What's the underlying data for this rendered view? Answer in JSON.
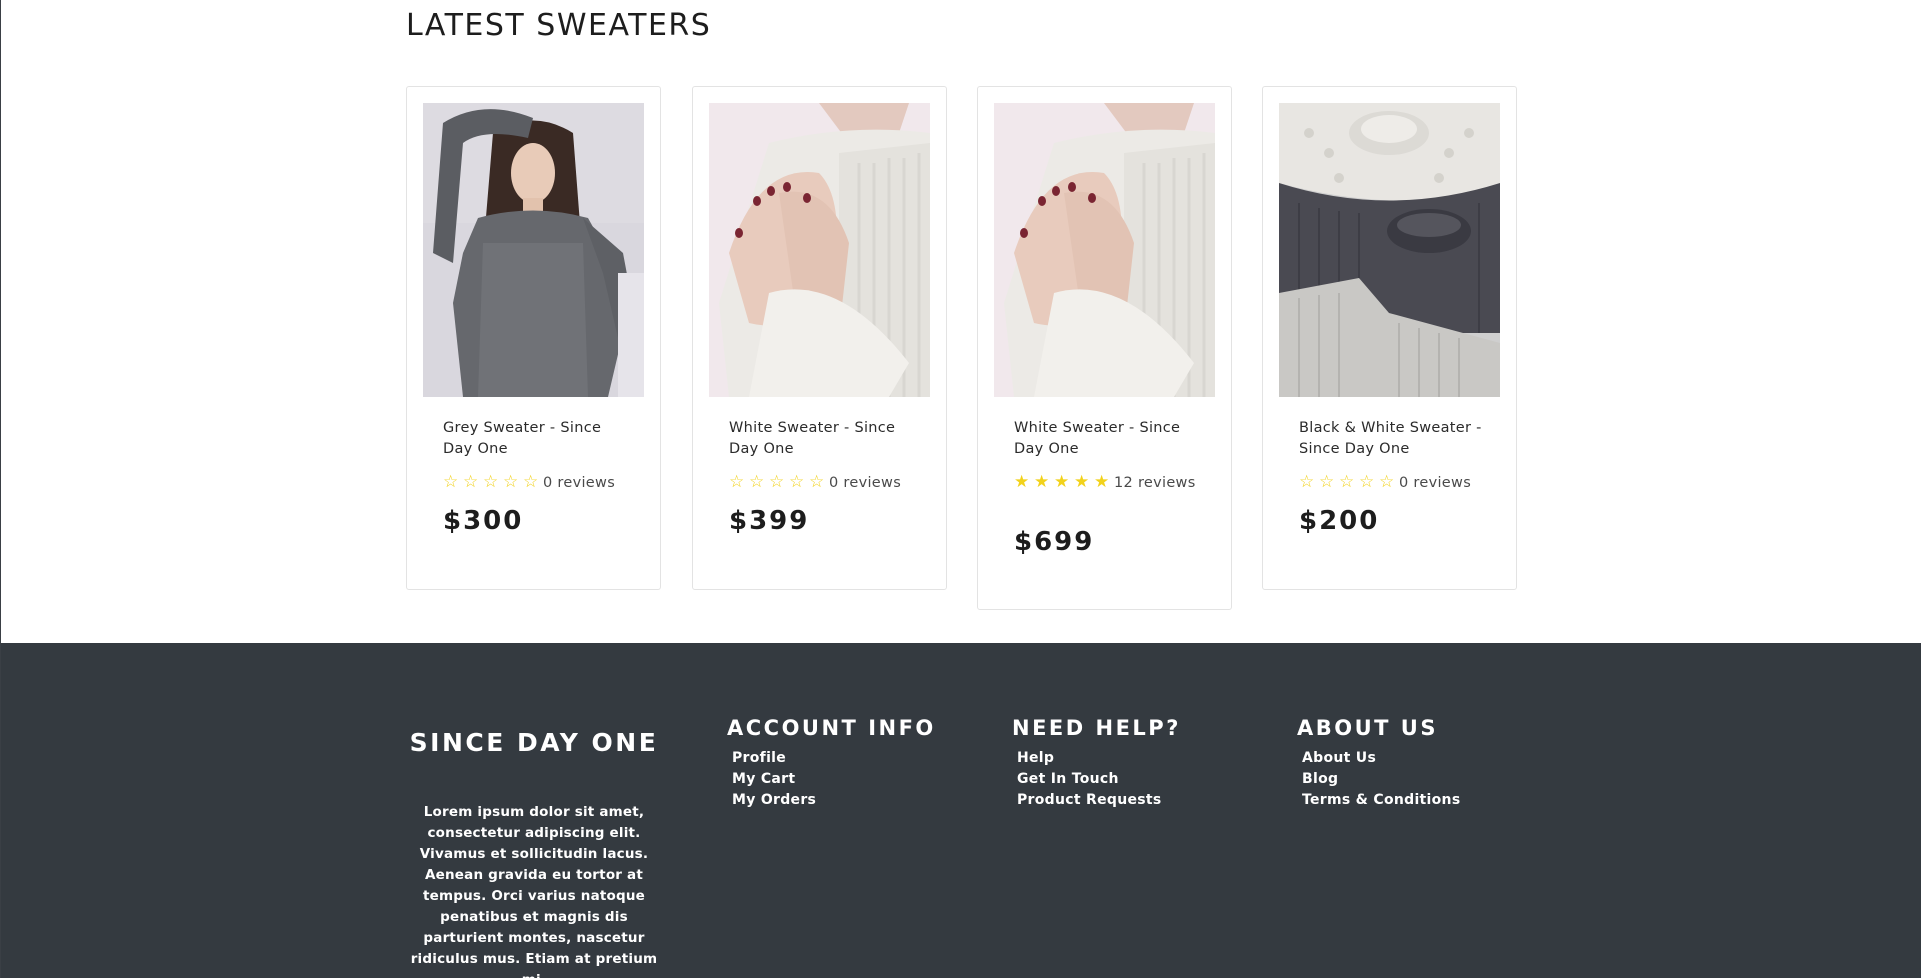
{
  "latest": {
    "title": "LATEST SWEATERS",
    "products": [
      {
        "name": "Grey Sweater - Since Day One",
        "image": "grey-sweater-model-photo",
        "rating": 0,
        "reviews": "0 reviews",
        "price": "$300"
      },
      {
        "name": "White Sweater - Since Day One",
        "image": "white-sweater-hands-photo",
        "rating": 0,
        "reviews": "0 reviews",
        "price": "$399"
      },
      {
        "name": "White Sweater - Since Day One",
        "image": "white-sweater-hands-photo",
        "rating": 5,
        "reviews": "12 reviews",
        "price": "$699"
      },
      {
        "name": "Black & White Sweater - Since Day One",
        "image": "folded-sweaters-photo",
        "rating": 0,
        "reviews": "0 reviews",
        "price": "$200"
      }
    ]
  },
  "footer": {
    "brand": "SINCE DAY ONE",
    "description": "Lorem ipsum dolor sit amet, consectetur adipiscing elit. Vivamus et sollicitudin lacus. Aenean gravida eu tortor at tempus. Orci varius natoque penatibus et magnis dis parturient montes, nascetur ridiculus mus. Etiam at pretium mi.",
    "columns": [
      {
        "title": "ACCOUNT INFO",
        "links": [
          "Profile",
          "My Cart",
          "My Orders"
        ]
      },
      {
        "title": "NEED HELP?",
        "links": [
          "Help",
          "Get In Touch",
          "Product Requests"
        ]
      },
      {
        "title": "ABOUT US",
        "links": [
          "About Us",
          "Blog",
          "Terms & Conditions"
        ]
      }
    ]
  },
  "colors": {
    "star": "#f2d21b",
    "footer_bg": "#343a40",
    "card_border": "#e3e3e3"
  },
  "icons": {
    "star_filled": "star-filled-icon",
    "star_empty": "star-outline-icon"
  }
}
